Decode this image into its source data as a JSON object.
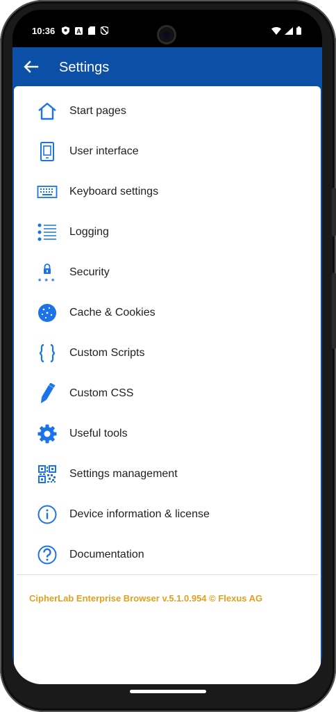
{
  "status": {
    "time": "10:36"
  },
  "appbar": {
    "title": "Settings"
  },
  "colors": {
    "primary": "#0b4fa6",
    "icon": "#1a73e8",
    "footer": "#e0a020"
  },
  "menu": [
    {
      "label": "Start pages",
      "icon": "home-icon"
    },
    {
      "label": "User interface",
      "icon": "tablet-icon"
    },
    {
      "label": "Keyboard settings",
      "icon": "keyboard-icon"
    },
    {
      "label": "Logging",
      "icon": "list-icon"
    },
    {
      "label": "Security",
      "icon": "lock-password-icon"
    },
    {
      "label": "Cache & Cookies",
      "icon": "cookie-icon"
    },
    {
      "label": "Custom Scripts",
      "icon": "braces-icon"
    },
    {
      "label": "Custom CSS",
      "icon": "pencil-icon"
    },
    {
      "label": "Useful tools",
      "icon": "gear-icon"
    },
    {
      "label": "Settings management",
      "icon": "qr-code-icon"
    },
    {
      "label": "Device information & license",
      "icon": "info-icon"
    },
    {
      "label": "Documentation",
      "icon": "help-icon"
    }
  ],
  "footer": {
    "text": "CipherLab Enterprise Browser v.5.1.0.954 © Flexus AG"
  }
}
